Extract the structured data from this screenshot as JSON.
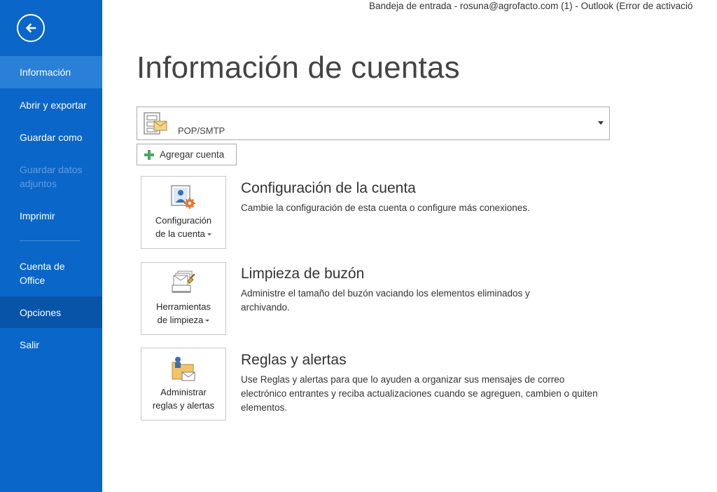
{
  "window": {
    "title": "Bandeja de entrada - rosuna@agrofacto.com (1) - Outlook (Error de activació"
  },
  "sidebar": {
    "back_icon": "back-arrow-icon",
    "items": [
      {
        "label": "Información",
        "state": "selected"
      },
      {
        "label": "Abrir y exportar",
        "state": "normal"
      },
      {
        "label": "Guardar como",
        "state": "normal"
      },
      {
        "label": "Guardar datos adjuntos",
        "state": "disabled"
      },
      {
        "label": "Imprimir",
        "state": "normal"
      },
      {
        "label": "Cuenta de Office",
        "state": "normal"
      },
      {
        "label": "Opciones",
        "state": "hover"
      },
      {
        "label": "Salir",
        "state": "normal"
      }
    ],
    "colors": {
      "background": "#0a66c9",
      "selected": "#2a7fd6",
      "hover": "#0854a8"
    }
  },
  "main": {
    "page_title": "Información de cuentas",
    "account": {
      "name": "",
      "type": "POP/SMTP",
      "icon": "mail-account-icon"
    },
    "add_account_label": "Agregar cuenta",
    "sections": [
      {
        "tile_line1": "Configuración",
        "tile_line2": "de la cuenta",
        "heading": "Configuración de la cuenta",
        "description": "Cambie la configuración de esta cuenta o configure más conexiones.",
        "icon": "account-settings-icon"
      },
      {
        "tile_line1": "Herramientas",
        "tile_line2": "de limpieza",
        "heading": "Limpieza de buzón",
        "description": "Administre el tamaño del buzón vaciando los elementos eliminados y archivando.",
        "icon": "cleanup-tools-icon"
      },
      {
        "tile_line1": "Administrar",
        "tile_line2": "reglas y alertas",
        "heading": "Reglas y alertas",
        "description": "Use Reglas y alertas para que lo ayuden a organizar sus mensajes de correo electrónico entrantes y reciba actualizaciones cuando se agreguen, cambien o quiten elementos.",
        "icon": "rules-alerts-icon"
      }
    ]
  }
}
